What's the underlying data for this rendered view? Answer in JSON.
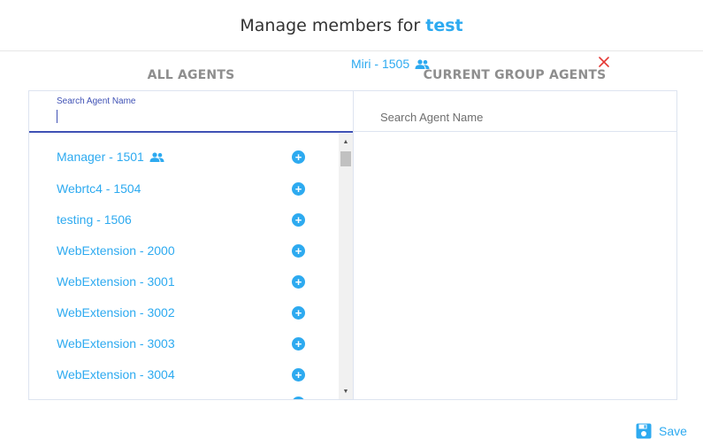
{
  "dialog": {
    "title_prefix": "Manage members for",
    "group_name": "test"
  },
  "columns": {
    "all_agents_title": "ALL AGENTS",
    "current_agents_title": "CURRENT GROUP AGENTS"
  },
  "search_all": {
    "label": "Search Agent Name",
    "value": ""
  },
  "search_current": {
    "placeholder": "Search Agent Name"
  },
  "all_agents": [
    {
      "label": "Manager - 1501",
      "is_group": true
    },
    {
      "label": "Webrtc4 - 1504",
      "is_group": false
    },
    {
      "label": "testing - 1506",
      "is_group": false
    },
    {
      "label": "WebExtension - 2000",
      "is_group": false
    },
    {
      "label": "WebExtension - 3001",
      "is_group": false
    },
    {
      "label": "WebExtension - 3002",
      "is_group": false
    },
    {
      "label": "WebExtension - 3003",
      "is_group": false
    },
    {
      "label": "WebExtension - 3004",
      "is_group": false
    }
  ],
  "current_agents": [
    {
      "label": "Miri - 1505",
      "is_group": true
    }
  ],
  "icons": {
    "add": "plus-circle-icon",
    "remove": "close-icon",
    "group": "people-icon",
    "save": "floppy-disk-icon"
  },
  "actions": {
    "save_label": "Save"
  },
  "colors": {
    "accent": "#2daaf0",
    "focus": "#3f51b5",
    "remove": "#e53935"
  }
}
